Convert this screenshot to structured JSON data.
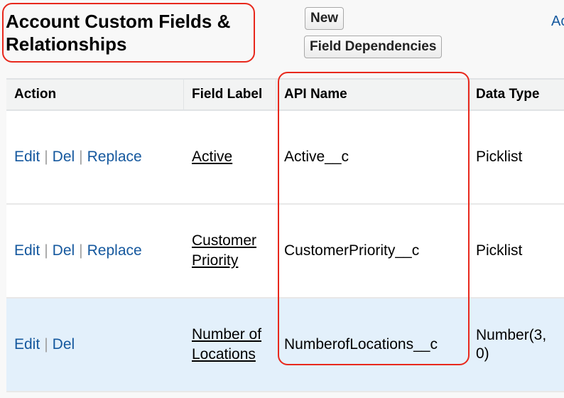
{
  "page": {
    "title": "Account Custom Fields & Relationships",
    "buttons": {
      "new": "New",
      "field_dependencies": "Field Dependencies"
    },
    "top_right_link": "Ac"
  },
  "table": {
    "headers": [
      "Action",
      "Field Label",
      "API Name",
      "Data Type"
    ],
    "rows": [
      {
        "actions": [
          "Edit",
          "Del",
          "Replace"
        ],
        "field_label": "Active",
        "api_name": "Active__c",
        "data_type": "Picklist",
        "highlighted": false
      },
      {
        "actions": [
          "Edit",
          "Del",
          "Replace"
        ],
        "field_label": "Customer Priority",
        "api_name": "CustomerPriority__c",
        "data_type": "Picklist",
        "highlighted": false
      },
      {
        "actions": [
          "Edit",
          "Del"
        ],
        "field_label": "Number of Locations",
        "api_name": "NumberofLocations__c",
        "data_type": "Number(3, 0)",
        "highlighted": true
      }
    ]
  },
  "colors": {
    "annotation": "#e8281c",
    "link": "#15589e",
    "row_highlight": "#e3f0fb"
  }
}
